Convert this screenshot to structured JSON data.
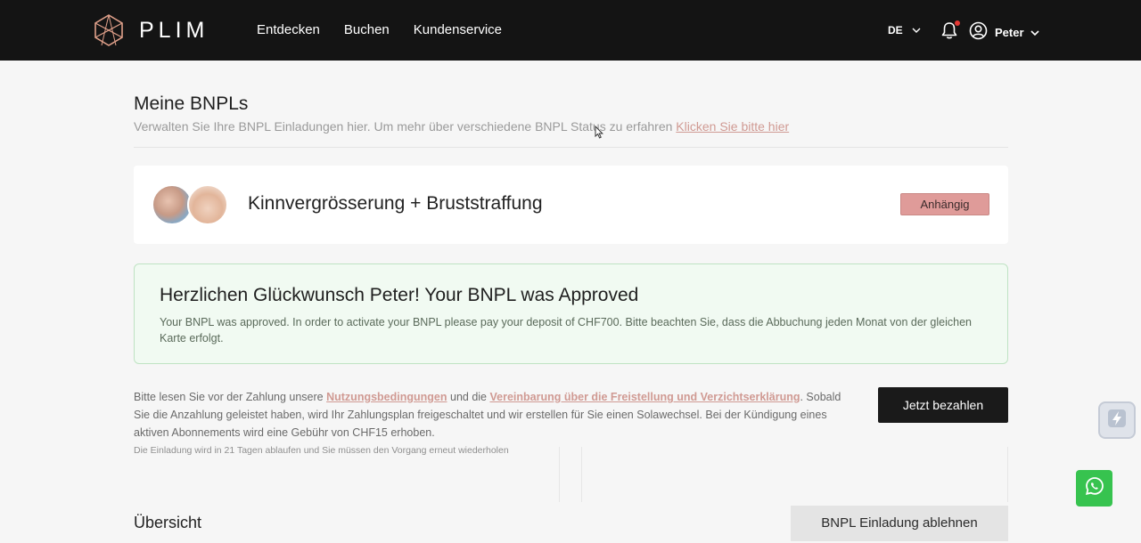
{
  "header": {
    "logo_text": "PLIM",
    "nav": [
      "Entdecken",
      "Buchen",
      "Kundenservice"
    ],
    "language": "DE",
    "user_name": "Peter",
    "notification_dot_color": "#e53935"
  },
  "page": {
    "title": "Meine BNPLs",
    "subtitle": "Verwalten Sie Ihre BNPL Einladungen hier. Um mehr über verschiedene BNPL Status zu erfahren ",
    "subtitle_link": "Klicken Sie bitte hier"
  },
  "bnpl_card": {
    "title": "Kinnvergrösserung + Bruststraffung",
    "status": "Anhängig",
    "status_color": "#df9b99"
  },
  "approval": {
    "title": "Herzlichen Glückwunsch Peter! Your BNPL was Approved",
    "text": "Your BNPL was approved. In order to activate your BNPL please pay your deposit of CHF700. Bitte beachten Sie, dass die Abbuchung jeden Monat von der gleichen Karte erfolgt."
  },
  "terms": {
    "text_1": "Bitte lesen Sie vor der Zahlung unsere ",
    "link_1": "Nutzungsbedingungen",
    "text_2": " und die ",
    "link_2": "Vereinbarung über die Freistellung und Verzichtserklärung",
    "text_3": ". Sobald Sie die Anzahlung geleistet haben, wird Ihr Zahlungsplan freigeschaltet und wir erstellen für Sie einen Solawechsel. Bei der Kündigung eines aktiven Abonnements wird eine Gebühr von CHF15 erhoben.",
    "expire_note": "Die Einladung wird in 21 Tagen ablaufen und Sie müssen den Vorgang erneut wiederholen"
  },
  "actions": {
    "pay_label": "Jetzt bezahlen",
    "decline_label": "BNPL Einladung ablehnen"
  },
  "overview": {
    "title": "Übersicht"
  },
  "icons": {
    "logo": "plim-logo-icon",
    "bell": "bell-icon",
    "user": "user-circle-icon",
    "chevron": "chevron-down-icon",
    "side_widget": "bolt-icon",
    "whatsapp": "whatsapp-icon"
  },
  "colors": {
    "topbar": "#141414",
    "accent_link": "#d09a93",
    "success_bg": "#f1faf2",
    "whatsapp": "#37c34f"
  }
}
